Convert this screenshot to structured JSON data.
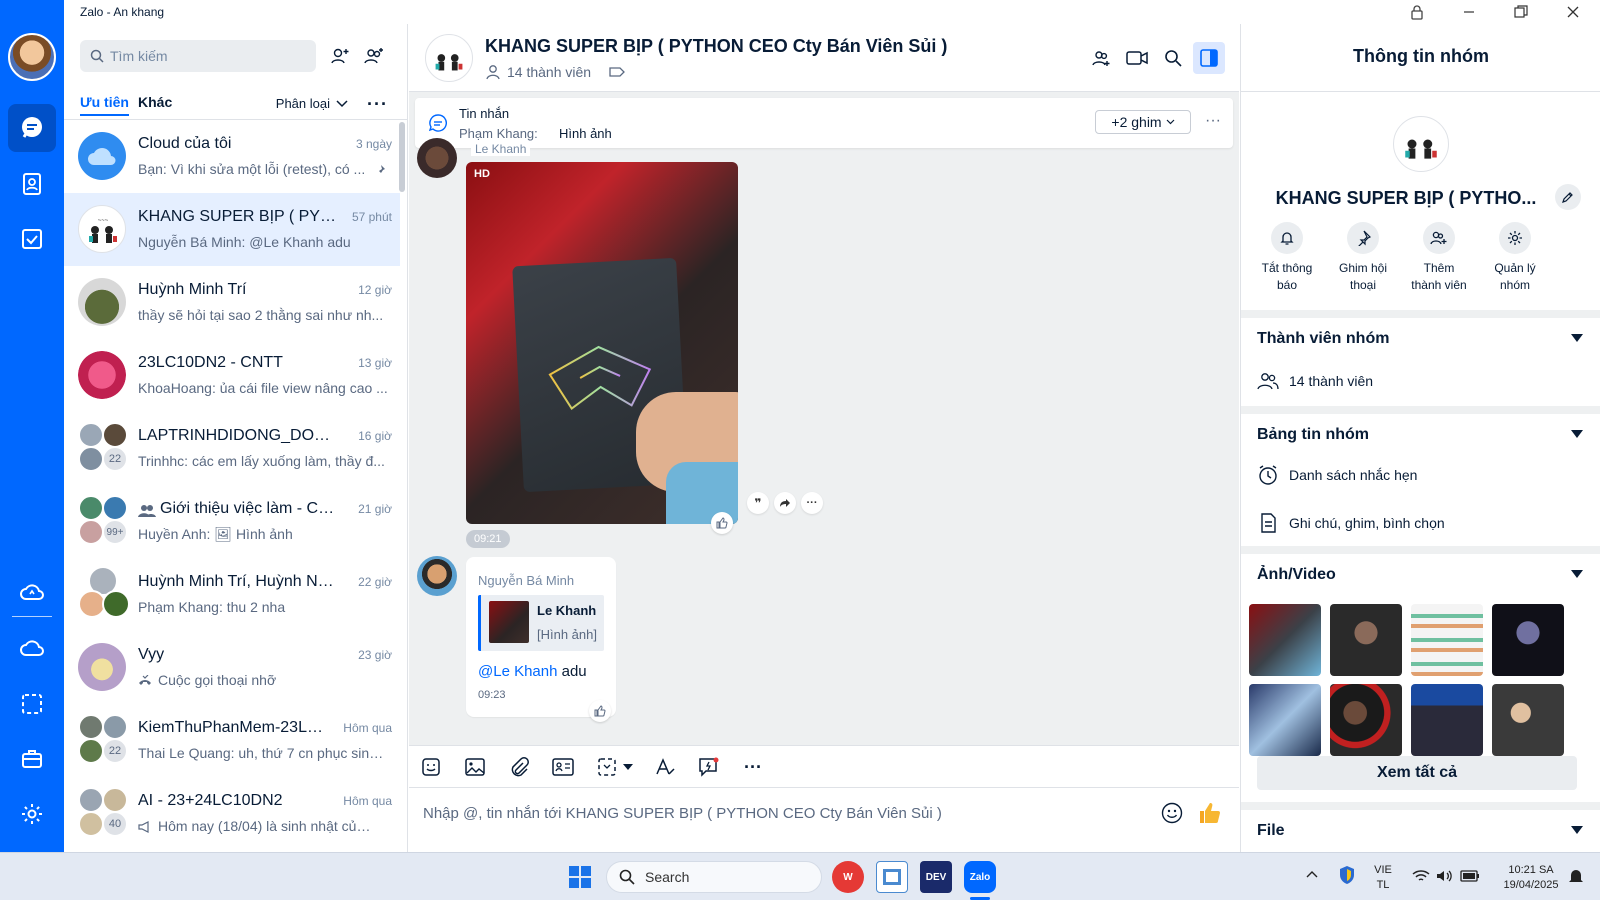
{
  "window": {
    "title": "Zalo - An khang"
  },
  "search": {
    "placeholder": "Tìm kiếm"
  },
  "tabs": {
    "priority": "Ưu tiên",
    "other": "Khác",
    "sort": "Phân loại"
  },
  "conversations": [
    {
      "name": "Cloud của tôi",
      "time": "3 ngày",
      "preview": "Bạn: Vì khi sửa một lỗi (retest), có ...",
      "avatar_color": "#2f8cf0"
    },
    {
      "name": "KHANG SUPER BỊP ( PYTH...",
      "time": "57 phút",
      "preview": "Nguyễn Bá Minh: @Le Khanh adu",
      "avatar_color": "#ffffff"
    },
    {
      "name": "Huỳnh Minh Trí",
      "time": "12 giờ",
      "preview": "thầy sẽ hỏi tại sao 2 thằng sai như nh...",
      "avatar_color": "#5b6b3a"
    },
    {
      "name": "23LC10DN2 - CNTT",
      "time": "13 giờ",
      "preview": "KhoaHoang: ủa cái file view nâng cao ...",
      "avatar_color": "#e0306a"
    },
    {
      "name": "LAPTRINHDIDONG_DONGN...",
      "time": "16 giờ",
      "preview": "Trinhhc: các em lấy xuống làm, thầy đ...",
      "badge": "22",
      "avatar_color": "#607080"
    },
    {
      "name": "Giới thiệu việc làm - CĐK...",
      "time": "21 giờ",
      "preview": "Huyền Anh: 🖼 Hình ảnh",
      "badge": "99+",
      "avatar_color": "#4a8a6a"
    },
    {
      "name": "Huỳnh Minh Trí, Huỳnh Nhậ...",
      "time": "22 giờ",
      "preview": "Phạm Khang: thu 2 nha",
      "avatar_color": "#8a8f99"
    },
    {
      "name": "Vyy",
      "time": "23 giờ",
      "preview": "Cuộc gọi thoại nhỡ",
      "avatar_color": "#b59fc9"
    },
    {
      "name": "KiemThuPhanMem-23LC1...",
      "time": "Hôm qua",
      "preview": "Thai Le Quang: uh, thứ 7 cn phục sinh ...",
      "badge": "22",
      "avatar_color": "#707a70"
    },
    {
      "name": "AI - 23+24LC10DN2",
      "time": "Hôm qua",
      "preview": "Hôm nay (18/04) là sinh nhật của Đ...",
      "badge": "40",
      "avatar_color": "#9aa5b2"
    }
  ],
  "chat": {
    "title": "KHANG SUPER BỊP ( PYTHON CEO Cty Bán Viên Sủi )",
    "members": "14 thành viên",
    "pinned": {
      "title": "Tin nhắn",
      "sender": "Phạm Khang:",
      "content": "Hình ảnh",
      "more_button": "+2 ghim"
    },
    "image_message": {
      "sender": "Le Khanh",
      "quality": "HD",
      "time": "09:21"
    },
    "reply_message": {
      "sender": "Nguyễn Bá Minh",
      "quote_name": "Le Khanh",
      "quote_text": "[Hình ảnh]",
      "mention": "@Le Khanh",
      "text": " adu",
      "time": "09:23"
    },
    "composer_placeholder": "Nhập @, tin nhắn tới KHANG SUPER BỊP ( PYTHON CEO Cty Bán Viên Sủi )"
  },
  "info": {
    "header": "Thông tin nhóm",
    "group_name": "KHANG SUPER BỊP ( PYTHO...",
    "actions": [
      {
        "line1": "Tắt thông",
        "line2": "báo"
      },
      {
        "line1": "Ghim hội",
        "line2": "thoại"
      },
      {
        "line1": "Thêm",
        "line2": "thành viên"
      },
      {
        "line1": "Quản lý",
        "line2": "nhóm"
      }
    ],
    "members_section": {
      "title": "Thành viên nhóm",
      "count": "14 thành viên"
    },
    "board_section": {
      "title": "Bảng tin nhóm",
      "reminders": "Danh sách nhắc hẹn",
      "notes": "Ghi chú, ghim, bình chọn"
    },
    "media_section": {
      "title": "Ảnh/Video",
      "see_all": "Xem tất cả"
    },
    "file_section": {
      "title": "File"
    }
  },
  "taskbar": {
    "search": "Search",
    "lang_top": "VIE",
    "lang_bottom": "TL",
    "time": "10:21 SA",
    "date": "19/04/2025"
  }
}
